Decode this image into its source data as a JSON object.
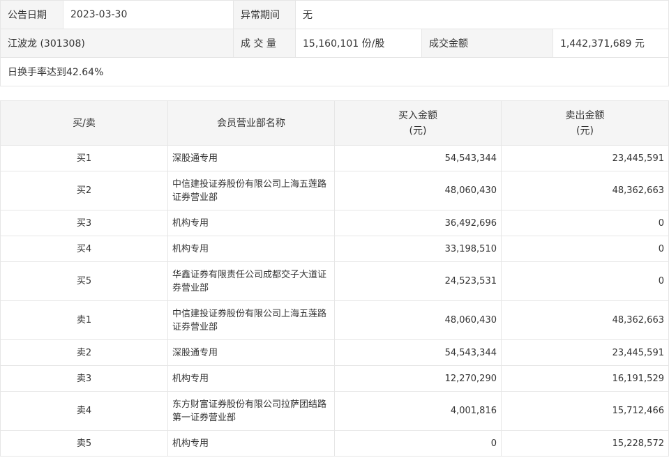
{
  "info": {
    "announce_date_label": "公告日期",
    "announce_date_value": "2023-03-30",
    "abnormal_period_label": "异常期间",
    "abnormal_period_value": "无",
    "stock": "江波龙 (301308)",
    "volume_label": "成 交 量",
    "volume_value": "15,160,101 份/股",
    "turnover_label": "成交金额",
    "turnover_value": "1,442,371,689 元",
    "summary": "日换手率达到42.64%"
  },
  "table": {
    "headers": {
      "type": "买/卖",
      "name": "会员营业部名称",
      "buy_line1": "买入金额",
      "buy_line2": "(元)",
      "sell_line1": "卖出金额",
      "sell_line2": "(元)"
    },
    "rows": [
      {
        "type": "买1",
        "name": "深股通专用",
        "buy": "54,543,344",
        "sell": "23,445,591"
      },
      {
        "type": "买2",
        "name": "中信建投证券股份有限公司上海五莲路证券营业部",
        "buy": "48,060,430",
        "sell": "48,362,663"
      },
      {
        "type": "买3",
        "name": "机构专用",
        "buy": "36,492,696",
        "sell": "0"
      },
      {
        "type": "买4",
        "name": "机构专用",
        "buy": "33,198,510",
        "sell": "0"
      },
      {
        "type": "买5",
        "name": "华鑫证券有限责任公司成都交子大道证券营业部",
        "buy": "24,523,531",
        "sell": "0"
      },
      {
        "type": "卖1",
        "name": "中信建投证券股份有限公司上海五莲路证券营业部",
        "buy": "48,060,430",
        "sell": "48,362,663"
      },
      {
        "type": "卖2",
        "name": "深股通专用",
        "buy": "54,543,344",
        "sell": "23,445,591"
      },
      {
        "type": "卖3",
        "name": "机构专用",
        "buy": "12,270,290",
        "sell": "16,191,529"
      },
      {
        "type": "卖4",
        "name": "东方财富证券股份有限公司拉萨团结路第一证券营业部",
        "buy": "4,001,816",
        "sell": "15,712,466"
      },
      {
        "type": "卖5",
        "name": "机构专用",
        "buy": "0",
        "sell": "15,228,572"
      }
    ]
  }
}
